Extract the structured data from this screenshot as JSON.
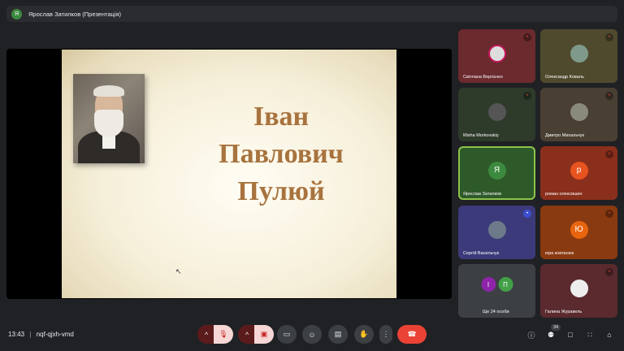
{
  "presenter": {
    "initial": "Я",
    "label": "Ярослав Затилков (Презентація)"
  },
  "slide": {
    "title_lines": [
      "Іван",
      "Павлович",
      "Пулюй"
    ]
  },
  "participants": [
    {
      "name": "Світлана Вергієнко",
      "bg": "#6b2a2e",
      "mute": "•"
    },
    {
      "name": "Олександр Коваль",
      "bg": "#4f4a2e",
      "mute": "•"
    },
    {
      "name": "Misha Morkovskiy",
      "bg": "#2e3a2a",
      "mute": "•"
    },
    {
      "name": "Дмитро Михальчук",
      "bg": "#4a3f33",
      "mute": "•"
    },
    {
      "name": "Ярослав Затилков",
      "bg": "#2e5a2a",
      "avatar": "Я",
      "avatar_bg": "#3c8a3f"
    },
    {
      "name": "роман олексишин",
      "bg": "#8a2f1c",
      "avatar": "р",
      "avatar_bg": "#e8541f",
      "mute": "•"
    },
    {
      "name": "Сергій Васильчук",
      "bg": "#3c3a7a",
      "mute": "•"
    },
    {
      "name": "юра ковтанюк",
      "bg": "#8a3a10",
      "avatar": "Ю",
      "avatar_bg": "#e8650f",
      "mute": "•"
    },
    {
      "name": "Ще 24 особи",
      "bg": "#3c4043"
    },
    {
      "name": "Галина Журавель",
      "bg": "#5a2a2e",
      "mute": "•"
    }
  ],
  "more": {
    "initials": [
      "І",
      "П"
    ],
    "colors": [
      "#8e24aa",
      "#43a047"
    ]
  },
  "bottom": {
    "time": "13:43",
    "separator": "|",
    "meeting_code": "nqf-qjxh-vmd",
    "people_count": "34"
  },
  "icons": {
    "chevron_up": "^",
    "mic_off": "🎙",
    "cam_off": "▣",
    "present": "▭",
    "emoji": "☺",
    "captions": "▤",
    "hand": "✋",
    "more": "⋮",
    "hang_up": "☎",
    "info": "ⓘ",
    "people": "⚉",
    "chat": "□",
    "activities": "∷",
    "lock": "⌂",
    "cursor": "↖"
  }
}
